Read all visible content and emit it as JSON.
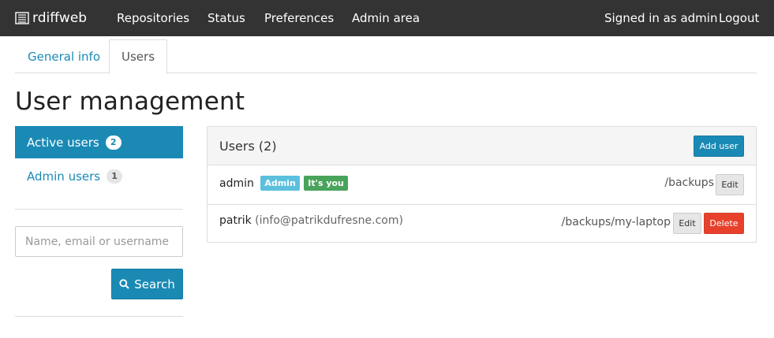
{
  "navbar": {
    "brand": "rdiffweb",
    "brand_icon": "server-icon",
    "links": [
      "Repositories",
      "Status",
      "Preferences",
      "Admin area"
    ],
    "signed_in": "Signed in as admin",
    "logout": "Logout"
  },
  "tabs": {
    "general": "General info",
    "users": "Users",
    "active": "Users"
  },
  "page_title": "User management",
  "sidebar": {
    "active_users": {
      "label": "Active users",
      "count": "2"
    },
    "admin_users": {
      "label": "Admin users",
      "count": "1"
    },
    "search_placeholder": "Name, email or username",
    "search_value": "",
    "search_button": "Search",
    "search_icon": "search-icon"
  },
  "panel": {
    "title": "Users (2)",
    "add_button": "Add user",
    "users": [
      {
        "username": "admin",
        "email": "",
        "labels": [
          "Admin",
          "It's you"
        ],
        "path": "/backups",
        "edit": "Edit"
      },
      {
        "username": "patrik",
        "email": "(info@patrikdufresne.com)",
        "path": "/backups/my-laptop",
        "edit": "Edit",
        "delete": "Delete"
      }
    ]
  },
  "colors": {
    "navbar": "#333333",
    "primary": "#1a8ab5",
    "label_info": "#5bc0de",
    "label_success": "#48a35b",
    "danger": "#e7402b"
  }
}
